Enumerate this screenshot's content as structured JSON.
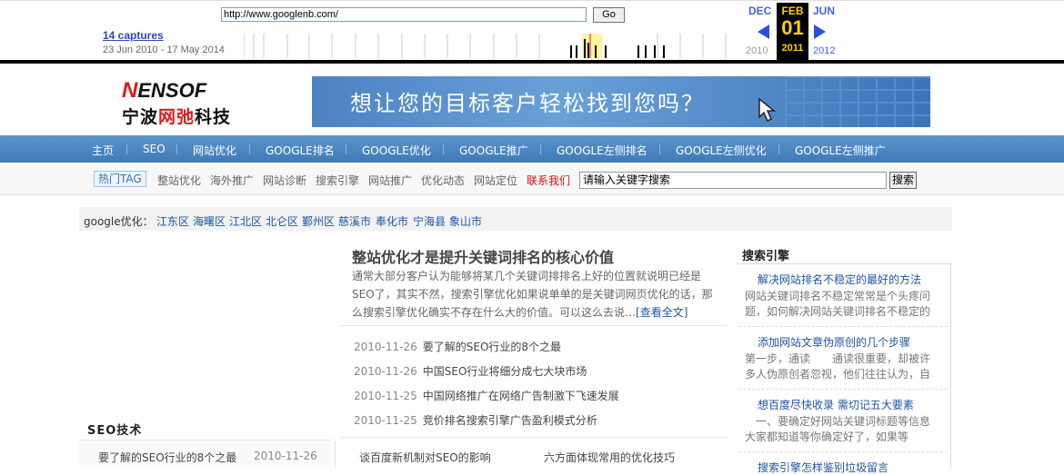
{
  "wayback": {
    "url": "http://www.googlenb.com/",
    "go_label": "Go",
    "captures": "14 captures",
    "date_range": "23 Jun 2010 - 17 May 2014",
    "prev_month": "DEC",
    "prev_year": "2010",
    "current_month": "FEB",
    "current_day": "01",
    "current_year": "2011",
    "next_month": "JUN",
    "next_year": "2012"
  },
  "logo": {
    "en_first": "N",
    "en_rest": "ENSOF",
    "cn_a": "宁波",
    "cn_red": "网弛",
    "cn_b": "科技"
  },
  "banner": {
    "text": "想让您的目标客户轻松找到您吗？"
  },
  "nav": [
    "主页",
    "SEO",
    "网站优化",
    "GOOGLE排名",
    "GOOGLE优化",
    "GOOGLE推广",
    "GOOGLE左侧排名",
    "GOOGLE左侧优化",
    "GOOGLE左侧推广"
  ],
  "tagbar": {
    "hot_tag": "热门TAG",
    "tags": [
      "整站优化",
      "海外推广",
      "网站诊断",
      "搜索引擎",
      "网站推广",
      "优化动态",
      "网站定位"
    ],
    "contact": "联系我们",
    "search_value": "请输入关键字搜索",
    "search_button": "搜索"
  },
  "citybar": {
    "label": "google优化：",
    "cities": [
      "江东区",
      "海曙区",
      "江北区",
      "北仑区",
      "鄞州区",
      "慈溪市",
      "奉化市",
      "宁海县",
      "象山市"
    ]
  },
  "article": {
    "title": "整站优化才是提升关键词排名的核心价值",
    "body": "通常大部分客户认为能够将某几个关键词排排名上好的位置就说明已经是SEO了，其实不然，搜索引擎优化如果说单单的是关键词网页优化的话，那么搜索引擎优化确实不存在什么大的价值。可以这么去说…",
    "more": "[查看全文]"
  },
  "news": [
    {
      "date": "2010-11-26",
      "title": "要了解的SEO行业的8个之最"
    },
    {
      "date": "2010-11-26",
      "title": "中国SEO行业将细分成七大块市场"
    },
    {
      "date": "2010-11-25",
      "title": "中国网络推广在网络广告制激下飞速发展"
    },
    {
      "date": "2010-11-25",
      "title": "竞价排名搜索引擎广告盈利模式分析"
    }
  ],
  "lower_links": [
    "谈百度新机制对SEO的影响",
    "六方面体现常用的优化技巧"
  ],
  "seo_section": {
    "title": "SEO技术",
    "item": "要了解的SEO行业的8个之最",
    "date": "2010-11-26"
  },
  "sidebar": {
    "title": "搜索引擎",
    "items": [
      {
        "heading": "解决网站排名不稳定的最好的方法",
        "text": "网站关键词排名不稳定常常是个头疼问题，如何解决网站关键词排名不稳定的"
      },
      {
        "heading": "添加网站文章伪原创的几个步骤",
        "text": "第一步，通读　　通读很重要，却被许多人伪原创者忽视，他们往往认为，自"
      },
      {
        "heading": "想百度尽快收录 需切记五大要素",
        "text": "　一、要确定好网站关键词标题等信息　　大家都知道等你确定好了，如果等"
      },
      {
        "heading": "搜索引擎怎样鉴别垃圾留言",
        "text": ""
      }
    ]
  }
}
